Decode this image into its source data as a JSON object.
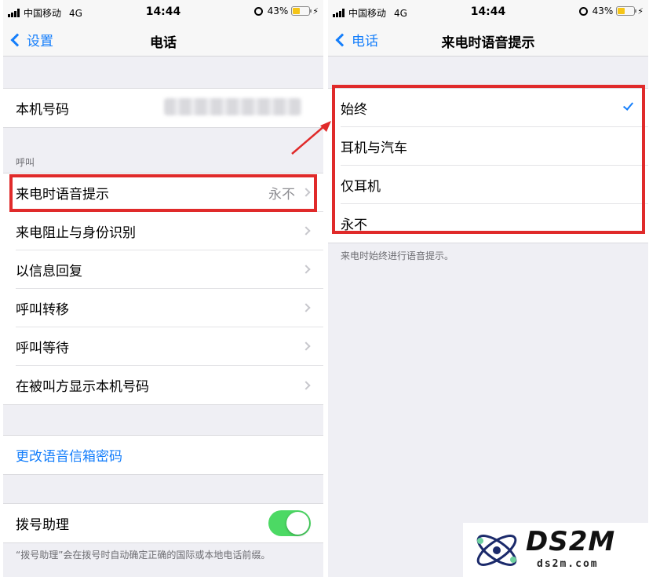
{
  "status_bar": {
    "carrier": "中国移动",
    "network": "4G",
    "time": "14:44",
    "battery": "43%",
    "battery_level": 0.43
  },
  "left_screen": {
    "back_label": "设置",
    "title": "电话",
    "my_number_label": "本机号码",
    "section_header": "呼叫",
    "rows": [
      {
        "label": "来电时语音提示",
        "value": "永不"
      },
      {
        "label": "来电阻止与身份识别"
      },
      {
        "label": "以信息回复"
      },
      {
        "label": "呼叫转移"
      },
      {
        "label": "呼叫等待"
      },
      {
        "label": "在被叫方显示本机号码"
      }
    ],
    "change_voicemail_password": "更改语音信箱密码",
    "dial_assist_label": "拨号助理",
    "dial_assist_on": true,
    "dial_assist_footnote": "“拨号助理”会在拨号时自动确定正确的国际或本地电话前缀。"
  },
  "right_screen": {
    "back_label": "电话",
    "title": "来电时语音提示",
    "options": [
      "始终",
      "耳机与汽车",
      "仅耳机",
      "永不"
    ],
    "selected_option": "始终",
    "footnote": "来电时始终进行语音提示。"
  },
  "watermark": {
    "logo_text": "DS2M",
    "domain": "ds2m.com"
  },
  "colors": {
    "accent": "#147efb",
    "highlight_box": "#e02a2a",
    "toggle_on": "#4cd964",
    "battery": "#f5c518"
  }
}
